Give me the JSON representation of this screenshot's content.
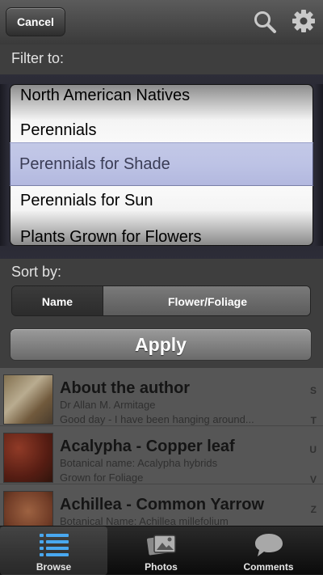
{
  "header": {
    "cancel_label": "Cancel",
    "search_icon": "search-icon",
    "settings_icon": "gear-icon"
  },
  "filter": {
    "label": "Filter to:",
    "options": [
      "North American Natives",
      "Perennials",
      "Perennials for Shade",
      "Perennials for Sun",
      "Plants Grown for Flowers"
    ],
    "selected": "Perennials for Shade"
  },
  "sort": {
    "label": "Sort by:",
    "options": [
      "Name",
      "Flower/Foliage"
    ],
    "selected": "Name"
  },
  "apply_label": "Apply",
  "list": {
    "rows": [
      {
        "title": "About the author",
        "line1": "Dr Allan M. Armitage",
        "line2": "Good day - I have been hanging around..."
      },
      {
        "title": "Acalypha - Copper leaf",
        "line1": "Botanical name: Acalypha hybrids",
        "line2": "Grown for Foliage"
      },
      {
        "title": "Achillea - Common Yarrow",
        "line1": "Botanical Name: Achillea millefolium",
        "line2": ""
      }
    ],
    "index_letters": [
      "S",
      "T",
      "U",
      "V",
      "Z"
    ]
  },
  "tabs": [
    {
      "label": "Browse",
      "icon": "list-icon",
      "active": true
    },
    {
      "label": "Photos",
      "icon": "photos-icon",
      "active": false
    },
    {
      "label": "Comments",
      "icon": "speech-bubble-icon",
      "active": false
    }
  ],
  "colors": {
    "picker_highlight": "#8c94d2",
    "background": "#3e3e3e"
  }
}
